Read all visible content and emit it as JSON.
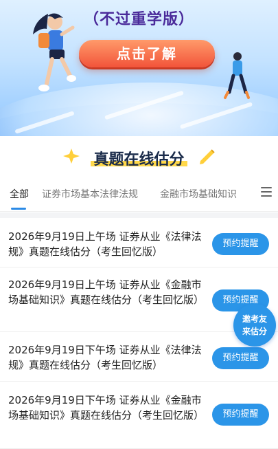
{
  "banner": {
    "subtitle": "（不过重学版）",
    "cta_label": "点击了解"
  },
  "section": {
    "title": "真题在线估分"
  },
  "tabs": [
    {
      "label": "全部",
      "active": true
    },
    {
      "label": "证券市场基本法律法规",
      "active": false
    },
    {
      "label": "金融市场基础知识",
      "active": false
    }
  ],
  "items": [
    {
      "title": "2026年9月19日上午场 证券从业《法律法规》真题在线估分（考生回忆版）",
      "button": "预约提醒"
    },
    {
      "title": "2026年9月19日上午场 证券从业《金融市场基础知识》真题在线估分（考生回忆版）",
      "button": "预约提醒"
    },
    {
      "title": "2026年9月19日下午场 证券从业《法律法规》真题在线估分（考生回忆版）",
      "button": "预约提醒"
    },
    {
      "title": "2026年9月19日下午场 证券从业《金融市场基础知识》真题在线估分（考生回忆版）",
      "button": "预约提醒"
    }
  ],
  "floating_badge": {
    "line1": "邀考友",
    "line2": "来估分"
  },
  "colors": {
    "accent": "#2b95e8",
    "cta": "#f2543a",
    "highlight": "#ffd84a"
  }
}
